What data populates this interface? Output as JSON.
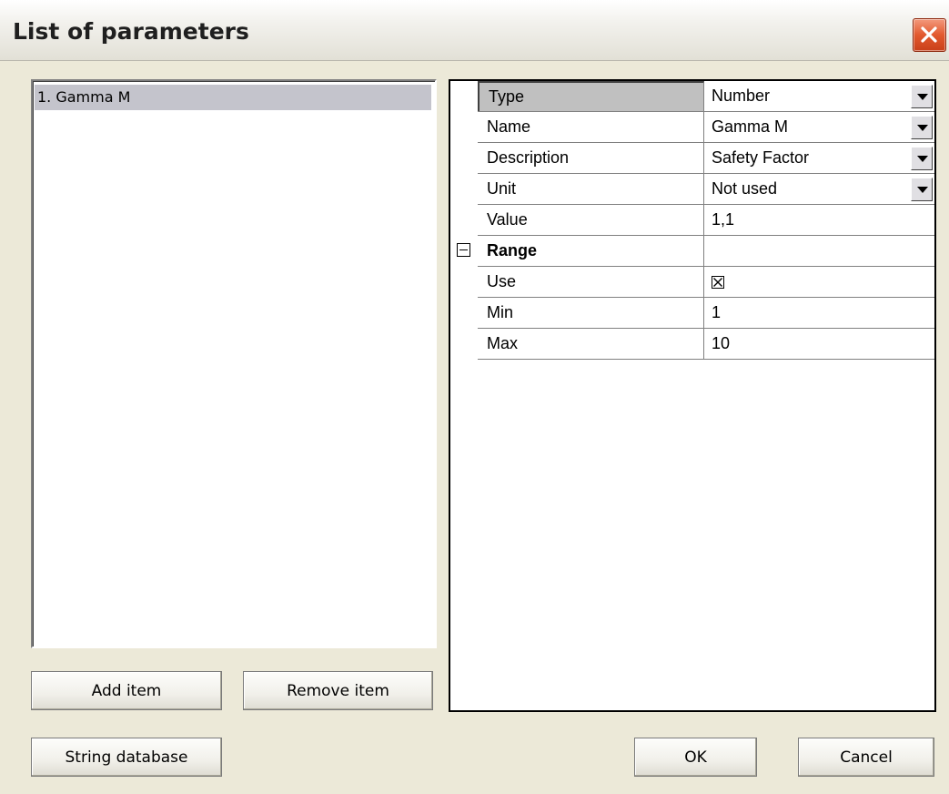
{
  "window": {
    "title": "List of parameters"
  },
  "list": {
    "items": [
      "1. Gamma M"
    ]
  },
  "buttons": {
    "add_item": "Add item",
    "remove_item": "Remove item",
    "string_database": "String database",
    "ok": "OK",
    "cancel": "Cancel"
  },
  "properties": {
    "type": {
      "label": "Type",
      "value": "Number"
    },
    "name": {
      "label": "Name",
      "value": "Gamma M"
    },
    "description": {
      "label": "Description",
      "value": "Safety Factor"
    },
    "unit": {
      "label": "Unit",
      "value": "Not used"
    },
    "value": {
      "label": "Value",
      "value": "1,1"
    },
    "range": {
      "label": "Range",
      "value": ""
    },
    "use": {
      "label": "Use",
      "checked": true
    },
    "min": {
      "label": "Min",
      "value": "1"
    },
    "max": {
      "label": "Max",
      "value": "10"
    }
  },
  "icons": {
    "close": "close-icon",
    "collapse": "collapse-minus-icon",
    "dropdown": "chevron-down-icon"
  },
  "colors": {
    "dialog_bg": "#ece9d8",
    "selection": "#c4c4cc",
    "close_red": "#e2592e"
  }
}
